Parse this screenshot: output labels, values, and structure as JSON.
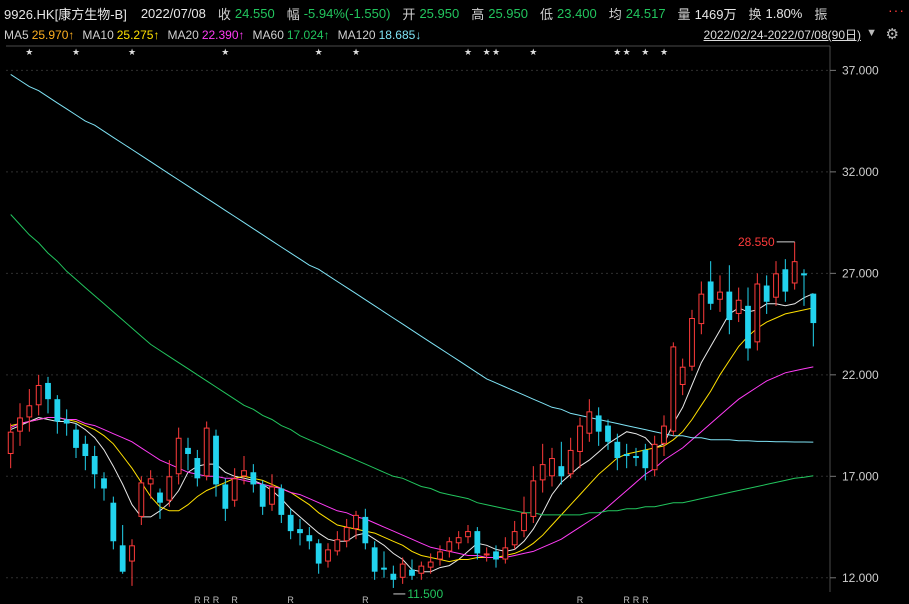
{
  "header": {
    "symbol": "9926.HK[康方生物-B]",
    "date": "2022/07/08",
    "close_label": "收",
    "close": "24.550",
    "change_label": "幅",
    "change": "-5.94%(-1.550)",
    "open_label": "开",
    "open": "25.950",
    "high_label": "高",
    "high": "25.950",
    "low_label": "低",
    "low": "23.400",
    "avg_label": "均",
    "avg": "24.517",
    "volume_label": "量",
    "volume": "1469万",
    "turnover_label": "换",
    "turnover": "1.80%",
    "amplitude_label": "振",
    "more_icon": "···"
  },
  "ma_bar": {
    "ma5_label": "MA5",
    "ma5": "25.970↑",
    "ma10_label": "MA10",
    "ma10": "25.275↑",
    "ma20_label": "MA20",
    "ma20": "22.390↑",
    "ma60_label": "MA60",
    "ma60": "17.024↑",
    "ma120_label": "MA120",
    "ma120": "18.685↓",
    "range": "2022/02/24-2022/07/08(90日)",
    "range_icon": "chevron-down-icon",
    "settings_icon": "gear-icon"
  },
  "colors": {
    "up": "#ff3b3b",
    "down": "#22d3ee",
    "ma5": "#e8e8e8",
    "ma10": "#ffe000",
    "ma20": "#ff3cf5",
    "ma60": "#22c55e",
    "ma120": "#7fe3f5"
  },
  "chart_data": {
    "type": "candlestick",
    "ylim": [
      11.3,
      38.3
    ],
    "y_ticks": [
      "12.000",
      "17.000",
      "22.000",
      "27.000",
      "32.000",
      "37.000"
    ],
    "annotations": {
      "max": "28.550",
      "min": "11.500"
    },
    "star_markers": [
      2,
      7,
      13,
      23,
      33,
      37,
      49,
      51,
      52,
      56,
      65,
      66,
      68,
      70
    ],
    "r_markers": [
      20,
      21,
      22,
      24,
      30,
      38,
      61,
      66,
      67,
      68
    ],
    "r_label": "R",
    "star_label": "★",
    "candles": [
      {
        "o": 18.1,
        "c": 19.2,
        "h": 19.6,
        "l": 17.4
      },
      {
        "o": 19.2,
        "c": 19.9,
        "h": 20.6,
        "l": 18.5
      },
      {
        "o": 19.9,
        "c": 20.5,
        "h": 21.3,
        "l": 19.2
      },
      {
        "o": 20.5,
        "c": 21.5,
        "h": 22.0,
        "l": 20.0
      },
      {
        "o": 21.6,
        "c": 20.8,
        "h": 21.9,
        "l": 20.1
      },
      {
        "o": 20.8,
        "c": 19.7,
        "h": 21.0,
        "l": 19.1
      },
      {
        "o": 19.8,
        "c": 19.6,
        "h": 20.3,
        "l": 19.0
      },
      {
        "o": 19.3,
        "c": 18.4,
        "h": 19.6,
        "l": 17.9
      },
      {
        "o": 18.6,
        "c": 18.0,
        "h": 19.0,
        "l": 17.3
      },
      {
        "o": 18.0,
        "c": 17.1,
        "h": 18.5,
        "l": 16.4
      },
      {
        "o": 16.9,
        "c": 16.4,
        "h": 17.2,
        "l": 15.8
      },
      {
        "o": 15.7,
        "c": 13.8,
        "h": 16.0,
        "l": 13.4
      },
      {
        "o": 13.6,
        "c": 12.3,
        "h": 14.6,
        "l": 12.2
      },
      {
        "o": 12.8,
        "c": 13.6,
        "h": 13.9,
        "l": 11.6
      },
      {
        "o": 15.0,
        "c": 16.7,
        "h": 17.0,
        "l": 14.6
      },
      {
        "o": 16.6,
        "c": 16.9,
        "h": 17.3,
        "l": 15.9
      },
      {
        "o": 16.2,
        "c": 15.7,
        "h": 16.4,
        "l": 14.9
      },
      {
        "o": 15.8,
        "c": 17.0,
        "h": 17.8,
        "l": 15.5
      },
      {
        "o": 17.1,
        "c": 18.9,
        "h": 19.4,
        "l": 16.6
      },
      {
        "o": 18.4,
        "c": 18.1,
        "h": 18.9,
        "l": 17.3
      },
      {
        "o": 17.9,
        "c": 16.9,
        "h": 18.3,
        "l": 16.5
      },
      {
        "o": 17.0,
        "c": 19.4,
        "h": 19.7,
        "l": 16.8
      },
      {
        "o": 19.0,
        "c": 16.6,
        "h": 19.3,
        "l": 16.0
      },
      {
        "o": 16.6,
        "c": 15.4,
        "h": 16.9,
        "l": 14.8
      },
      {
        "o": 15.8,
        "c": 16.9,
        "h": 17.4,
        "l": 15.5
      },
      {
        "o": 17.0,
        "c": 17.3,
        "h": 18.0,
        "l": 16.6
      },
      {
        "o": 17.2,
        "c": 16.6,
        "h": 17.6,
        "l": 16.2
      },
      {
        "o": 16.6,
        "c": 15.5,
        "h": 16.8,
        "l": 15.1
      },
      {
        "o": 15.6,
        "c": 16.5,
        "h": 17.1,
        "l": 15.3
      },
      {
        "o": 16.4,
        "c": 15.1,
        "h": 16.6,
        "l": 14.7
      },
      {
        "o": 15.1,
        "c": 14.3,
        "h": 15.4,
        "l": 13.9
      },
      {
        "o": 14.4,
        "c": 14.2,
        "h": 14.9,
        "l": 13.6
      },
      {
        "o": 14.1,
        "c": 13.8,
        "h": 14.5,
        "l": 13.4
      },
      {
        "o": 13.7,
        "c": 12.7,
        "h": 13.9,
        "l": 12.2
      },
      {
        "o": 12.8,
        "c": 13.4,
        "h": 13.7,
        "l": 12.5
      },
      {
        "o": 13.3,
        "c": 13.9,
        "h": 14.3,
        "l": 13.1
      },
      {
        "o": 13.8,
        "c": 14.5,
        "h": 14.9,
        "l": 13.5
      },
      {
        "o": 14.4,
        "c": 15.1,
        "h": 15.3,
        "l": 13.9
      },
      {
        "o": 15.0,
        "c": 13.7,
        "h": 15.4,
        "l": 13.4
      },
      {
        "o": 13.5,
        "c": 12.3,
        "h": 13.8,
        "l": 11.9
      },
      {
        "o": 12.5,
        "c": 12.4,
        "h": 13.3,
        "l": 12.0
      },
      {
        "o": 12.2,
        "c": 11.9,
        "h": 12.6,
        "l": 11.5
      },
      {
        "o": 12.0,
        "c": 12.7,
        "h": 13.0,
        "l": 11.7
      },
      {
        "o": 12.4,
        "c": 12.1,
        "h": 12.9,
        "l": 11.9
      },
      {
        "o": 12.2,
        "c": 12.6,
        "h": 12.8,
        "l": 11.9
      },
      {
        "o": 12.5,
        "c": 12.8,
        "h": 13.2,
        "l": 12.2
      },
      {
        "o": 12.9,
        "c": 13.3,
        "h": 13.6,
        "l": 12.6
      },
      {
        "o": 13.3,
        "c": 13.8,
        "h": 14.0,
        "l": 13.0
      },
      {
        "o": 13.7,
        "c": 14.0,
        "h": 14.3,
        "l": 13.4
      },
      {
        "o": 14.0,
        "c": 14.3,
        "h": 14.6,
        "l": 13.7
      },
      {
        "o": 14.3,
        "c": 13.2,
        "h": 14.5,
        "l": 12.9
      },
      {
        "o": 13.1,
        "c": 13.2,
        "h": 13.5,
        "l": 12.8
      },
      {
        "o": 13.3,
        "c": 12.9,
        "h": 13.6,
        "l": 12.5
      },
      {
        "o": 12.9,
        "c": 13.5,
        "h": 14.0,
        "l": 12.7
      },
      {
        "o": 13.6,
        "c": 14.3,
        "h": 14.8,
        "l": 13.4
      },
      {
        "o": 14.3,
        "c": 15.2,
        "h": 16.0,
        "l": 14.0
      },
      {
        "o": 15.0,
        "c": 16.8,
        "h": 17.5,
        "l": 14.7
      },
      {
        "o": 16.8,
        "c": 17.6,
        "h": 18.6,
        "l": 16.2
      },
      {
        "o": 17.0,
        "c": 17.9,
        "h": 18.4,
        "l": 16.5
      },
      {
        "o": 17.5,
        "c": 17.0,
        "h": 18.7,
        "l": 16.6
      },
      {
        "o": 17.1,
        "c": 18.3,
        "h": 18.9,
        "l": 16.9
      },
      {
        "o": 18.2,
        "c": 19.5,
        "h": 19.9,
        "l": 17.4
      },
      {
        "o": 19.1,
        "c": 20.2,
        "h": 20.8,
        "l": 18.7
      },
      {
        "o": 20.0,
        "c": 19.2,
        "h": 20.4,
        "l": 18.5
      },
      {
        "o": 19.5,
        "c": 18.7,
        "h": 19.8,
        "l": 18.3
      },
      {
        "o": 18.7,
        "c": 17.9,
        "h": 19.1,
        "l": 17.3
      },
      {
        "o": 18.1,
        "c": 18.0,
        "h": 18.6,
        "l": 17.4
      },
      {
        "o": 18.0,
        "c": 17.9,
        "h": 18.4,
        "l": 17.5
      },
      {
        "o": 18.3,
        "c": 17.4,
        "h": 18.6,
        "l": 16.8
      },
      {
        "o": 17.3,
        "c": 18.6,
        "h": 19.0,
        "l": 17.0
      },
      {
        "o": 18.6,
        "c": 19.5,
        "h": 20.0,
        "l": 18.0
      },
      {
        "o": 19.2,
        "c": 23.4,
        "h": 23.6,
        "l": 19.0
      },
      {
        "o": 21.5,
        "c": 22.4,
        "h": 22.8,
        "l": 21.0
      },
      {
        "o": 22.4,
        "c": 24.8,
        "h": 25.2,
        "l": 22.2
      },
      {
        "o": 24.5,
        "c": 26.0,
        "h": 26.6,
        "l": 24.0
      },
      {
        "o": 26.6,
        "c": 25.5,
        "h": 27.6,
        "l": 25.2
      },
      {
        "o": 25.7,
        "c": 26.1,
        "h": 26.9,
        "l": 25.1
      },
      {
        "o": 26.1,
        "c": 24.7,
        "h": 27.4,
        "l": 24.0
      },
      {
        "o": 25.0,
        "c": 25.7,
        "h": 26.3,
        "l": 24.6
      },
      {
        "o": 25.4,
        "c": 23.3,
        "h": 26.3,
        "l": 22.7
      },
      {
        "o": 23.6,
        "c": 26.5,
        "h": 27.0,
        "l": 23.2
      },
      {
        "o": 26.4,
        "c": 25.6,
        "h": 26.9,
        "l": 25.0
      },
      {
        "o": 25.8,
        "c": 27.0,
        "h": 27.6,
        "l": 25.4
      },
      {
        "o": 27.2,
        "c": 26.1,
        "h": 27.7,
        "l": 25.6
      },
      {
        "o": 26.5,
        "c": 27.6,
        "h": 28.55,
        "l": 26.2
      },
      {
        "o": 27.0,
        "c": 26.9,
        "h": 27.2,
        "l": 25.4
      },
      {
        "o": 26.0,
        "c": 24.55,
        "h": 26.0,
        "l": 23.4
      }
    ],
    "series": [
      {
        "name": "MA5",
        "values": [
          19.3,
          19.5,
          19.7,
          19.9,
          19.8,
          19.7,
          19.7,
          19.6,
          19.3,
          18.9,
          18.3,
          17.5,
          16.6,
          15.6,
          15.0,
          15.0,
          15.3,
          15.7,
          16.3,
          17.2,
          17.5,
          17.6,
          17.6,
          17.2,
          17.0,
          16.9,
          16.8,
          16.6,
          16.3,
          15.9,
          15.4,
          15.0,
          14.6,
          14.2,
          13.9,
          13.8,
          13.8,
          14.1,
          14.2,
          13.9,
          13.6,
          13.2,
          12.9,
          12.4,
          12.3,
          12.3,
          12.5,
          12.6,
          12.9,
          13.3,
          13.7,
          13.6,
          13.4,
          13.3,
          13.4,
          13.8,
          14.4,
          15.2,
          16.1,
          16.7,
          17.1,
          17.5,
          17.8,
          18.2,
          18.6,
          18.9,
          19.2,
          19.1,
          18.9,
          18.4,
          18.6,
          19.6,
          20.4,
          21.5,
          22.6,
          23.4,
          24.2,
          25.0,
          25.3,
          25.1,
          25.2,
          25.5,
          25.5,
          25.4,
          25.5,
          25.8,
          26.0
        ]
      },
      {
        "name": "MA10",
        "values": [
          19.5,
          19.6,
          19.7,
          19.8,
          19.9,
          19.9,
          19.8,
          19.7,
          19.5,
          19.3,
          19.0,
          18.6,
          18.0,
          17.4,
          16.7,
          16.0,
          15.5,
          15.3,
          15.3,
          15.6,
          16.0,
          16.3,
          16.5,
          16.7,
          16.9,
          17.0,
          16.9,
          16.8,
          16.6,
          16.4,
          16.2,
          15.9,
          15.6,
          15.2,
          14.9,
          14.6,
          14.5,
          14.4,
          14.3,
          14.2,
          14.0,
          13.8,
          13.6,
          13.3,
          13.1,
          13.0,
          12.9,
          12.8,
          12.9,
          12.9,
          13.0,
          13.0,
          13.0,
          13.1,
          13.2,
          13.4,
          13.7,
          14.1,
          14.6,
          15.1,
          15.6,
          16.1,
          16.6,
          17.1,
          17.5,
          17.9,
          18.1,
          18.2,
          18.3,
          18.4,
          18.5,
          18.8,
          19.2,
          19.8,
          20.5,
          21.2,
          22.0,
          22.7,
          23.4,
          23.9,
          24.3,
          24.6,
          24.8,
          25.0,
          25.1,
          25.2,
          25.3
        ]
      },
      {
        "name": "MA20",
        "values": [
          19.4,
          19.6,
          19.7,
          19.8,
          19.9,
          19.9,
          19.8,
          19.8,
          19.6,
          19.5,
          19.3,
          19.1,
          18.9,
          18.7,
          18.4,
          18.1,
          17.8,
          17.6,
          17.4,
          17.2,
          17.1,
          17.0,
          17.0,
          16.9,
          16.9,
          16.8,
          16.7,
          16.6,
          16.5,
          16.4,
          16.2,
          16.1,
          15.9,
          15.7,
          15.5,
          15.3,
          15.2,
          15.0,
          14.9,
          14.7,
          14.5,
          14.3,
          14.1,
          13.9,
          13.7,
          13.5,
          13.4,
          13.3,
          13.2,
          13.1,
          13.1,
          13.0,
          13.0,
          13.0,
          13.1,
          13.2,
          13.3,
          13.5,
          13.7,
          13.9,
          14.2,
          14.5,
          14.8,
          15.1,
          15.5,
          15.9,
          16.3,
          16.7,
          17.1,
          17.4,
          17.8,
          18.1,
          18.4,
          18.8,
          19.2,
          19.6,
          20.0,
          20.4,
          20.8,
          21.1,
          21.4,
          21.7,
          21.9,
          22.1,
          22.2,
          22.3,
          22.39
        ]
      },
      {
        "name": "MA60",
        "values": [
          29.9,
          29.4,
          28.9,
          28.5,
          28.0,
          27.6,
          27.1,
          26.7,
          26.3,
          25.9,
          25.5,
          25.1,
          24.7,
          24.3,
          23.9,
          23.5,
          23.2,
          22.9,
          22.6,
          22.3,
          22.0,
          21.7,
          21.4,
          21.1,
          20.8,
          20.5,
          20.3,
          20.0,
          19.8,
          19.5,
          19.3,
          19.0,
          18.8,
          18.6,
          18.4,
          18.2,
          18.0,
          17.8,
          17.6,
          17.4,
          17.2,
          17.0,
          16.9,
          16.7,
          16.5,
          16.4,
          16.2,
          16.1,
          16.0,
          15.9,
          15.7,
          15.6,
          15.5,
          15.4,
          15.3,
          15.2,
          15.2,
          15.1,
          15.1,
          15.1,
          15.1,
          15.1,
          15.2,
          15.2,
          15.3,
          15.3,
          15.4,
          15.4,
          15.5,
          15.5,
          15.6,
          15.7,
          15.7,
          15.8,
          15.9,
          16.0,
          16.1,
          16.2,
          16.3,
          16.4,
          16.5,
          16.6,
          16.7,
          16.8,
          16.9,
          16.95,
          17.024
        ]
      },
      {
        "name": "MA120",
        "values": [
          36.8,
          36.5,
          36.2,
          36.0,
          35.7,
          35.4,
          35.1,
          34.8,
          34.5,
          34.3,
          34.0,
          33.7,
          33.4,
          33.1,
          32.8,
          32.5,
          32.2,
          31.9,
          31.6,
          31.3,
          31.0,
          30.7,
          30.4,
          30.1,
          29.8,
          29.5,
          29.2,
          28.9,
          28.6,
          28.3,
          28.0,
          27.7,
          27.4,
          27.2,
          26.9,
          26.6,
          26.3,
          26.0,
          25.7,
          25.4,
          25.1,
          24.8,
          24.5,
          24.2,
          23.9,
          23.6,
          23.3,
          23.0,
          22.7,
          22.4,
          22.1,
          21.8,
          21.6,
          21.4,
          21.2,
          21.0,
          20.8,
          20.6,
          20.4,
          20.3,
          20.1,
          20.0,
          19.9,
          19.8,
          19.7,
          19.6,
          19.5,
          19.4,
          19.3,
          19.2,
          19.1,
          19.0,
          19.0,
          18.9,
          18.9,
          18.8,
          18.8,
          18.8,
          18.75,
          18.75,
          18.72,
          18.72,
          18.7,
          18.7,
          18.69,
          18.69,
          18.685
        ]
      }
    ]
  }
}
